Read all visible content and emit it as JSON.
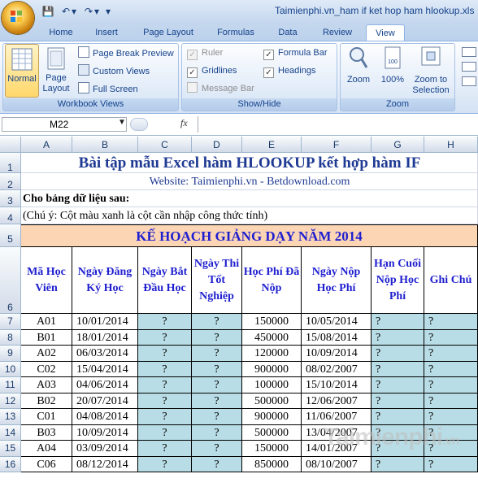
{
  "window": {
    "title": "Taimienphi.vn_ham if ket hop ham hlookup.xls"
  },
  "quick_access": [
    {
      "icon": "save-icon",
      "glyph": "💾"
    },
    {
      "icon": "undo-icon",
      "glyph": "↶"
    },
    {
      "icon": "undo-dropdown-icon",
      "glyph": "▾"
    },
    {
      "icon": "redo-icon",
      "glyph": "↷"
    },
    {
      "icon": "redo-dropdown-icon",
      "glyph": "▾"
    },
    {
      "icon": "customize-qat-icon",
      "glyph": "▾"
    }
  ],
  "tabs": [
    "Home",
    "Insert",
    "Page Layout",
    "Formulas",
    "Data",
    "Review",
    "View"
  ],
  "active_tab": "View",
  "ribbon": {
    "workbook_views": {
      "label": "Workbook Views",
      "normal": "Normal",
      "page_layout": "Page Layout",
      "page_break_preview": "Page Break Preview",
      "custom_views": "Custom Views",
      "full_screen": "Full Screen"
    },
    "show_hide": {
      "label": "Show/Hide",
      "ruler": "Ruler",
      "gridlines": "Gridlines",
      "message_bar": "Message Bar",
      "formula_bar": "Formula Bar",
      "headings": "Headings",
      "ruler_checked": true,
      "gridlines_checked": true,
      "message_bar_checked": false,
      "formula_bar_checked": true,
      "headings_checked": true
    },
    "zoom": {
      "label": "Zoom",
      "zoom": "Zoom",
      "zoom100": "100%",
      "zoom_to_selection": "Zoom to Selection"
    }
  },
  "formula_bar": {
    "name_box": "M22",
    "fx": "fx",
    "content": ""
  },
  "columns": [
    "A",
    "B",
    "C",
    "D",
    "E",
    "F",
    "G",
    "H"
  ],
  "sheet": {
    "title": "Bài tập mẫu Excel hàm HLOOKUP kết hợp hàm IF",
    "website": "Website: Taimienphi.vn - Betdownload.com",
    "intro": "Cho bảng dữ liệu sau:",
    "note": "(Chú ý: Cột màu xanh là cột cần nhập công thức tính)",
    "plan_title": "KẾ HOẠCH GIẢNG DẠY NĂM 2014",
    "headers": [
      "Mã Học Viên",
      "Ngày Đăng Ký Học",
      "Ngày Bắt Đầu Học",
      "Ngày Thi Tốt Nghiệp",
      "Học Phí Đã Nộp",
      "Ngày Nộp Học Phí",
      "Hạn Cuối Nộp Học Phí",
      "Ghi Chú"
    ],
    "rows": [
      {
        "num": "7",
        "cells": [
          "A01",
          "10/01/2014",
          "?",
          "?",
          "150000",
          "10/05/2014",
          "?",
          "?"
        ]
      },
      {
        "num": "8",
        "cells": [
          "B01",
          "18/01/2014",
          "?",
          "?",
          "450000",
          "15/08/2014",
          "?",
          "?"
        ]
      },
      {
        "num": "9",
        "cells": [
          "A02",
          "06/03/2014",
          "?",
          "?",
          "120000",
          "10/09/2014",
          "?",
          "?"
        ]
      },
      {
        "num": "10",
        "cells": [
          "C02",
          "15/04/2014",
          "?",
          "?",
          "900000",
          "08/02/2007",
          "?",
          "?"
        ]
      },
      {
        "num": "11",
        "cells": [
          "A03",
          "04/06/2014",
          "?",
          "?",
          "100000",
          "15/10/2014",
          "?",
          "?"
        ]
      },
      {
        "num": "12",
        "cells": [
          "B02",
          "20/07/2014",
          "?",
          "?",
          "500000",
          "12/06/2007",
          "?",
          "?"
        ]
      },
      {
        "num": "13",
        "cells": [
          "C01",
          "04/08/2014",
          "?",
          "?",
          "900000",
          "11/06/2007",
          "?",
          "?"
        ]
      },
      {
        "num": "14",
        "cells": [
          "B03",
          "10/09/2014",
          "?",
          "?",
          "500000",
          "13/04/2007",
          "?",
          "?"
        ]
      },
      {
        "num": "15",
        "cells": [
          "A04",
          "03/09/2014",
          "?",
          "?",
          "150000",
          "14/01/2007",
          "?",
          "?"
        ]
      },
      {
        "num": "16",
        "cells": [
          "C06",
          "08/12/2014",
          "?",
          "?",
          "850000",
          "08/10/2007",
          "?",
          "?"
        ]
      }
    ]
  },
  "watermark": {
    "text": "Taimienphi",
    "suffix": ".vn"
  },
  "colors": {
    "teal": "#b9dde6",
    "peach": "#fcd5b4",
    "header_text": "#1f1fd0",
    "title_text": "#1f3a93"
  }
}
